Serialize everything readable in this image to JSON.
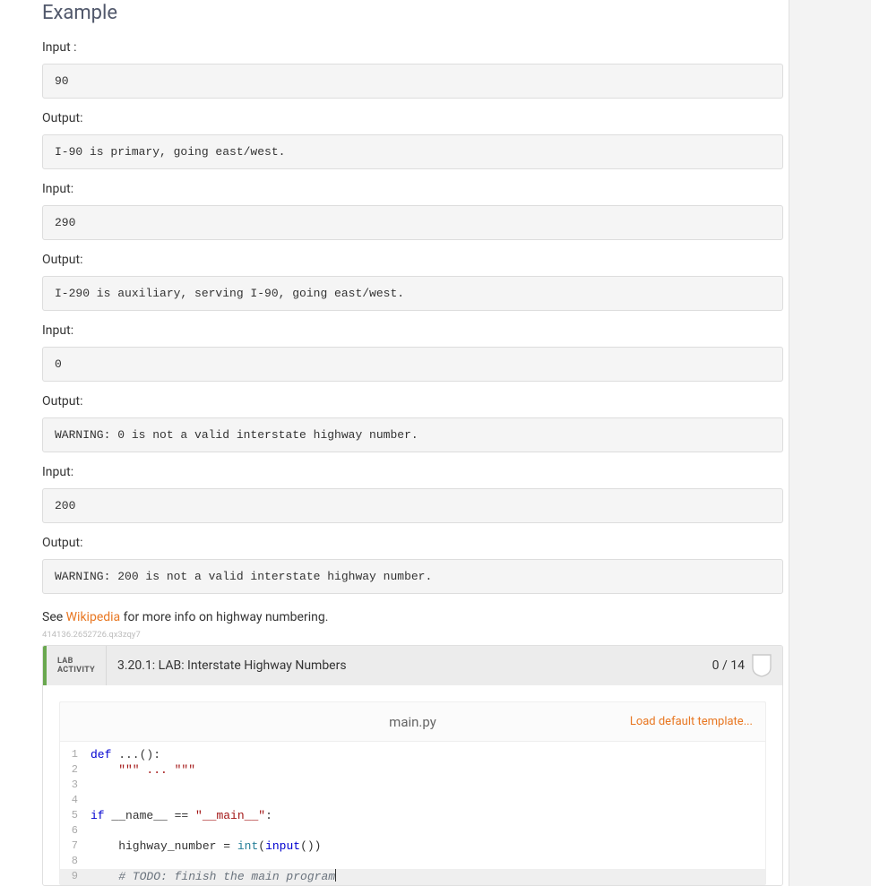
{
  "section_title": "Example",
  "examples": [
    {
      "input_label": "Input :",
      "input_value": "90",
      "output_label": "Output:",
      "output_value": "I-90 is primary, going east/west."
    },
    {
      "input_label": "Input:",
      "input_value": "290",
      "output_label": "Output:",
      "output_value": "I-290 is auxiliary, serving I-90, going east/west."
    },
    {
      "input_label": "Input:",
      "input_value": "0",
      "output_label": "Output:",
      "output_value": "WARNING: 0 is not a valid interstate highway number."
    },
    {
      "input_label": "Input:",
      "input_value": "200",
      "output_label": "Output:",
      "output_value": "WARNING: 200 is not a valid interstate highway number."
    }
  ],
  "note": {
    "prefix": "See ",
    "link_text": "Wikipedia",
    "suffix": " for more info on highway numbering."
  },
  "watermark": "414136.2652726.qx3zqy7",
  "lab": {
    "tag_line1": "LAB",
    "tag_line2": "ACTIVITY",
    "title": "3.20.1: LAB: Interstate Highway Numbers",
    "score": "0 / 14"
  },
  "editor": {
    "filename": "main.py",
    "action_label": "Load default template...",
    "code": {
      "l1_def": "def",
      "l1_rest": " ...():",
      "l2": "    \"\"\" ... \"\"\"",
      "l3": "",
      "l4": "",
      "l5_if": "if",
      "l5_name": " __name__",
      "l5_eq": " == ",
      "l5_str": "\"__main__\"",
      "l5_colon": ":",
      "l6": "",
      "l7_pre": "    highway_number ",
      "l7_eq": "= ",
      "l7_int": "int",
      "l7_open": "(",
      "l7_input": "input",
      "l7_close": "())",
      "l8": "",
      "l9": "    # TODO: finish the main program"
    }
  }
}
